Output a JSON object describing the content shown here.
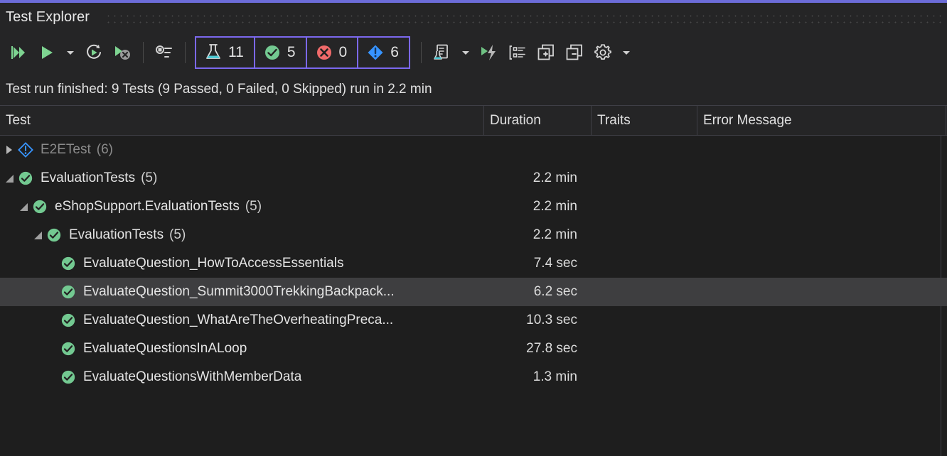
{
  "window": {
    "title": "Test Explorer",
    "accent_color": "#6c6cd8"
  },
  "toolbar": {
    "buttons": [
      {
        "name": "run-all-tests-button",
        "icon": "run-all-icon",
        "label": "Run All Tests"
      },
      {
        "name": "run-button",
        "icon": "run-icon",
        "label": "Run"
      },
      {
        "name": "run-dropdown-button",
        "icon": "chevron-down-icon",
        "label": "Run Options"
      },
      {
        "name": "repeat-last-run-button",
        "icon": "repeat-run-icon",
        "label": "Repeat Last Run"
      },
      {
        "name": "cancel-run-button",
        "icon": "stop-run-icon",
        "label": "Cancel Test Run"
      },
      {
        "name": "playlist-button",
        "icon": "playlist-icon",
        "label": "Playlist"
      }
    ],
    "right_buttons": [
      {
        "name": "test-detail-summary-button",
        "icon": "test-document-icon",
        "label": "Test Detail Summary"
      },
      {
        "name": "test-detail-dropdown",
        "icon": "chevron-down-icon",
        "label": "Test Detail Options"
      },
      {
        "name": "live-unit-testing-button",
        "icon": "run-lightning-icon",
        "label": "Live Unit Testing"
      },
      {
        "name": "group-by-button",
        "icon": "group-by-icon",
        "label": "Group By"
      },
      {
        "name": "expand-all-button",
        "icon": "expand-all-icon",
        "label": "Expand All"
      },
      {
        "name": "collapse-all-button",
        "icon": "collapse-all-icon",
        "label": "Collapse All"
      },
      {
        "name": "settings-button",
        "icon": "gear-icon",
        "label": "Settings"
      },
      {
        "name": "settings-dropdown",
        "icon": "chevron-down-icon",
        "label": "Settings Options"
      }
    ],
    "counters": [
      {
        "name": "total-tests-counter",
        "icon": "flask-icon",
        "value": "11",
        "color": "#4ec9d4"
      },
      {
        "name": "passed-tests-counter",
        "icon": "check-circle-icon",
        "value": "5",
        "color": "#73c991"
      },
      {
        "name": "failed-tests-counter",
        "icon": "error-circle-icon",
        "value": "0",
        "color": "#f06a6a"
      },
      {
        "name": "notrun-tests-counter",
        "icon": "info-diamond-icon",
        "value": "6",
        "color": "#3794ff"
      }
    ],
    "counters_border_color": "#7b68ee"
  },
  "status": {
    "text": "Test run finished: 9 Tests (9 Passed, 0 Failed, 0 Skipped) run in 2.2 min"
  },
  "grid": {
    "columns": [
      {
        "key": "test",
        "label": "Test"
      },
      {
        "key": "duration",
        "label": "Duration"
      },
      {
        "key": "traits",
        "label": "Traits"
      },
      {
        "key": "error",
        "label": "Error Message"
      }
    ],
    "rows": [
      {
        "name": "E2ETest",
        "label": "E2ETest",
        "count": "(6)",
        "indent": 0,
        "expander": "collapsed",
        "icon": "info-diamond-icon",
        "state": "not-run",
        "muted": true,
        "duration": "",
        "traits": "",
        "error": "",
        "selected": false
      },
      {
        "name": "EvaluationTests",
        "label": "EvaluationTests",
        "count": "(5)",
        "indent": 0,
        "expander": "expanded",
        "icon": "check-circle-icon",
        "state": "passed",
        "muted": false,
        "duration": "2.2 min",
        "traits": "",
        "error": "",
        "selected": false
      },
      {
        "name": "eShopSupport.EvaluationTests",
        "label": "eShopSupport.EvaluationTests",
        "count": "(5)",
        "indent": 1,
        "expander": "expanded",
        "icon": "check-circle-icon",
        "state": "passed",
        "muted": false,
        "duration": "2.2 min",
        "traits": "",
        "error": "",
        "selected": false
      },
      {
        "name": "EvaluationTests-class",
        "label": "EvaluationTests",
        "count": "(5)",
        "indent": 2,
        "expander": "expanded",
        "icon": "check-circle-icon",
        "state": "passed",
        "muted": false,
        "duration": "2.2 min",
        "traits": "",
        "error": "",
        "selected": false
      },
      {
        "name": "EvaluateQuestion_HowToAccessEssentials",
        "label": "EvaluateQuestion_HowToAccessEssentials",
        "count": "",
        "indent": 3,
        "expander": "none",
        "icon": "check-circle-icon",
        "state": "passed",
        "muted": false,
        "duration": "7.4 sec",
        "traits": "",
        "error": "",
        "selected": false
      },
      {
        "name": "EvaluateQuestion_Summit3000TrekkingBackpack",
        "label": "EvaluateQuestion_Summit3000TrekkingBackpack...",
        "count": "",
        "indent": 3,
        "expander": "none",
        "icon": "check-circle-icon",
        "state": "passed",
        "muted": false,
        "duration": "6.2 sec",
        "traits": "",
        "error": "",
        "selected": true
      },
      {
        "name": "EvaluateQuestion_WhatAreTheOverheatingPrecautions",
        "label": "EvaluateQuestion_WhatAreTheOverheatingPreca...",
        "count": "",
        "indent": 3,
        "expander": "none",
        "icon": "check-circle-icon",
        "state": "passed",
        "muted": false,
        "duration": "10.3 sec",
        "traits": "",
        "error": "",
        "selected": false
      },
      {
        "name": "EvaluateQuestionsInALoop",
        "label": "EvaluateQuestionsInALoop",
        "count": "",
        "indent": 3,
        "expander": "none",
        "icon": "check-circle-icon",
        "state": "passed",
        "muted": false,
        "duration": "27.8 sec",
        "traits": "",
        "error": "",
        "selected": false
      },
      {
        "name": "EvaluateQuestionsWithMemberData",
        "label": "EvaluateQuestionsWithMemberData",
        "count": "",
        "indent": 3,
        "expander": "none",
        "icon": "check-circle-icon",
        "state": "passed",
        "muted": false,
        "duration": "1.3 min",
        "traits": "",
        "error": "",
        "selected": false
      }
    ]
  }
}
